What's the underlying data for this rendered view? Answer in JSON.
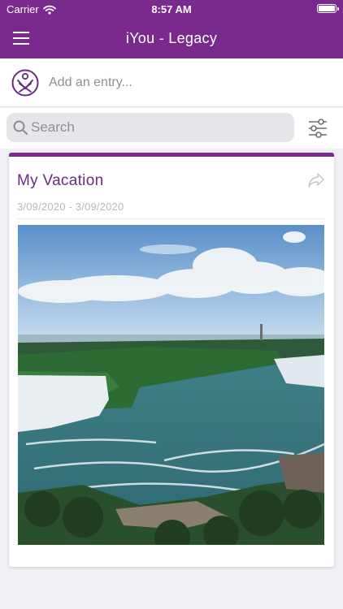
{
  "status_bar": {
    "carrier": "Carrier",
    "time": "8:57 AM"
  },
  "navbar": {
    "title": "iYou - Legacy",
    "menu_icon": "hamburger-menu-icon"
  },
  "add_entry": {
    "placeholder": "Add an entry...",
    "logo": "iyou-logo"
  },
  "search": {
    "placeholder": "Search",
    "filter_icon": "sliders-icon"
  },
  "entries": [
    {
      "title": "My Vacation",
      "date_range": "3/09/2020 - 3/09/2020",
      "share_icon": "share-arrow-icon",
      "photo": "waterfall-landscape-photo"
    }
  ],
  "colors": {
    "brand": "#7a2a8c",
    "title": "#6a2b7e",
    "date": "#b8b8bc",
    "background": "#efeff4"
  }
}
